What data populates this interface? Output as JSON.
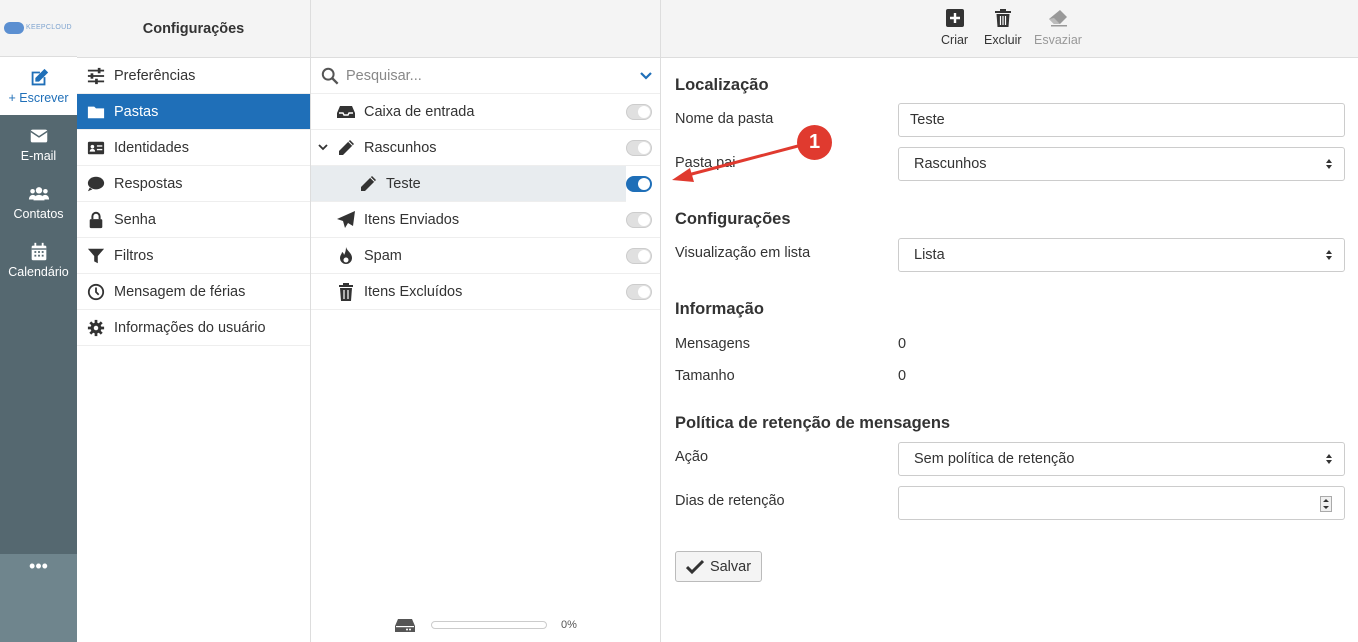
{
  "app": {
    "brand": "KEEPCLOUD"
  },
  "rail": {
    "compose": "+ Escrever",
    "items": [
      {
        "label": "E-mail",
        "icon": "envelope-icon"
      },
      {
        "label": "Contatos",
        "icon": "users-icon"
      },
      {
        "label": "Calendário",
        "icon": "calendar-icon"
      }
    ],
    "more": "•••"
  },
  "settings": {
    "title": "Configurações",
    "items": [
      {
        "label": "Preferências",
        "icon": "sliders-icon"
      },
      {
        "label": "Pastas",
        "icon": "folder-icon",
        "active": true
      },
      {
        "label": "Identidades",
        "icon": "id-card-icon"
      },
      {
        "label": "Respostas",
        "icon": "comment-icon"
      },
      {
        "label": "Senha",
        "icon": "lock-icon"
      },
      {
        "label": "Filtros",
        "icon": "filter-icon"
      },
      {
        "label": "Mensagem de férias",
        "icon": "clock-icon"
      },
      {
        "label": "Informações do usuário",
        "icon": "gear-icon"
      }
    ]
  },
  "folders": {
    "search_placeholder": "Pesquisar...",
    "items": [
      {
        "label": "Caixa de entrada",
        "icon": "inbox-icon",
        "subscribed": false
      },
      {
        "label": "Rascunhos",
        "icon": "pencil-icon",
        "subscribed": false,
        "expanded": true
      },
      {
        "label": "Teste",
        "icon": "pencil-icon",
        "subscribed": true,
        "selected": true
      },
      {
        "label": "Itens Enviados",
        "icon": "paper-plane-icon",
        "subscribed": false
      },
      {
        "label": "Spam",
        "icon": "fire-icon",
        "subscribed": false
      },
      {
        "label": "Itens Excluídos",
        "icon": "trash-icon",
        "subscribed": false
      }
    ],
    "quota_percent": "0%"
  },
  "toolbar": {
    "create": "Criar",
    "delete": "Excluir",
    "empty": "Esvaziar"
  },
  "form": {
    "location_title": "Localização",
    "folder_name_label": "Nome da pasta",
    "folder_name_value": "Teste",
    "parent_label": "Pasta pai",
    "parent_value": "Rascunhos",
    "settings_title": "Configurações",
    "list_view_label": "Visualização em lista",
    "list_view_value": "Lista",
    "info_title": "Informação",
    "messages_label": "Mensagens",
    "messages_value": "0",
    "size_label": "Tamanho",
    "size_value": "0",
    "retention_title": "Política de retenção de mensagens",
    "action_label": "Ação",
    "action_value": "Sem política de retenção",
    "retention_days_label": "Dias de retenção",
    "retention_days_value": "",
    "save_label": "Salvar"
  },
  "annotation": {
    "number": "1",
    "color": "#e03a2f"
  },
  "colors": {
    "accent": "#1f6fb8",
    "rail": "#556870"
  }
}
